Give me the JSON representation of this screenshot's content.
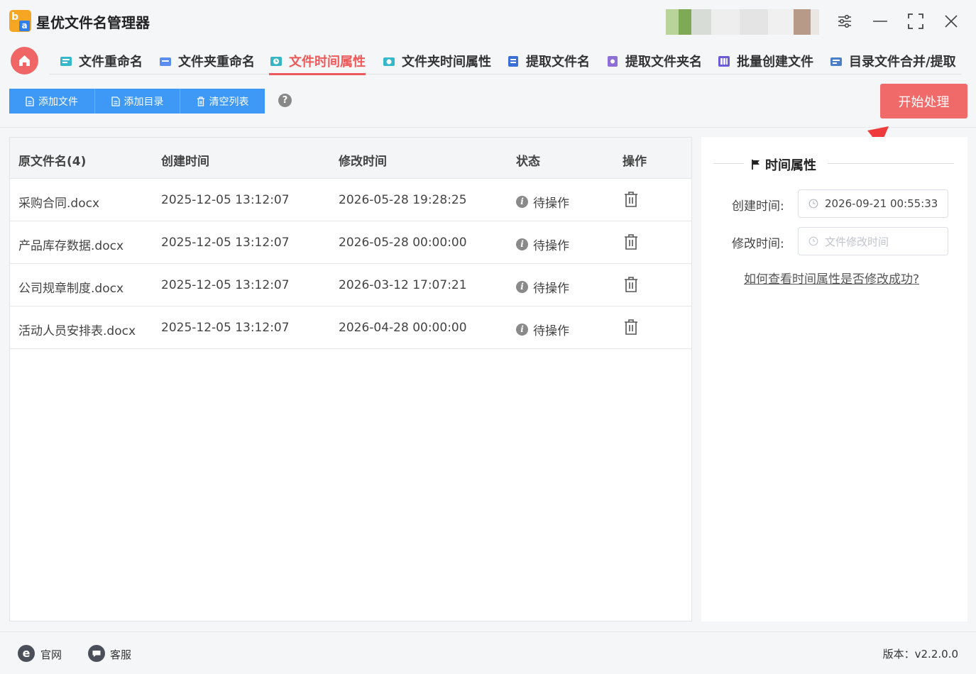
{
  "app": {
    "title": "星优文件名管理器",
    "logo_text_1": "b",
    "logo_text_2": "a"
  },
  "window_controls": [
    "settings-icon",
    "minimize-icon",
    "maximize-icon",
    "close-icon"
  ],
  "nav": {
    "tabs": [
      {
        "label": "文件重命名",
        "icon": "file-rename-icon",
        "color": "#35b8c9"
      },
      {
        "label": "文件夹重命名",
        "icon": "folder-rename-icon",
        "color": "#5b8def"
      },
      {
        "label": "文件时间属性",
        "icon": "file-time-icon",
        "color": "#36b5c4",
        "active": true
      },
      {
        "label": "文件夹时间属性",
        "icon": "folder-time-icon",
        "color": "#35b8c9"
      },
      {
        "label": "提取文件名",
        "icon": "extract-filename-icon",
        "color": "#3a6fd8"
      },
      {
        "label": "提取文件夹名",
        "icon": "extract-foldername-icon",
        "color": "#8e6fd8"
      },
      {
        "label": "批量创建文件",
        "icon": "batch-create-icon",
        "color": "#6a5bd8"
      },
      {
        "label": "目录文件合并/提取",
        "icon": "dir-merge-icon",
        "color": "#4a7fc8"
      }
    ]
  },
  "toolbar": {
    "buttons": [
      {
        "label": "添加文件",
        "icon": "add-file-icon"
      },
      {
        "label": "添加目录",
        "icon": "add-dir-icon"
      },
      {
        "label": "清空列表",
        "icon": "clear-list-icon"
      }
    ],
    "help": "?",
    "start_label": "开始处理"
  },
  "table": {
    "headers": [
      "原文件名(4)",
      "创建时间",
      "修改时间",
      "状态",
      "操作"
    ],
    "rows": [
      {
        "name": "采购合同.docx",
        "created": "2025-12-05 13:12:07",
        "modified": "2026-05-28 19:28:25",
        "status": "待操作"
      },
      {
        "name": "产品库存数据.docx",
        "created": "2025-12-05 13:12:07",
        "modified": "2026-05-28 00:00:00",
        "status": "待操作"
      },
      {
        "name": "公司规章制度.docx",
        "created": "2025-12-05 13:12:07",
        "modified": "2026-03-12 17:07:21",
        "status": "待操作"
      },
      {
        "name": "活动人员安排表.docx",
        "created": "2025-12-05 13:12:07",
        "modified": "2026-04-28 00:00:00",
        "status": "待操作"
      }
    ]
  },
  "side": {
    "title": "时间属性",
    "create_label": "创建时间:",
    "create_value": "2026-09-21 00:55:33",
    "modify_label": "修改时间:",
    "modify_placeholder": "文件修改时间",
    "help_link": "如何查看时间属性是否修改成功?"
  },
  "footer": {
    "website": "官网",
    "support": "客服",
    "version": "版本：v2.2.0.0"
  },
  "colors": {
    "accent": "#ee5a5a",
    "primary": "#3d99f5",
    "start_button": "#f06a6a"
  }
}
